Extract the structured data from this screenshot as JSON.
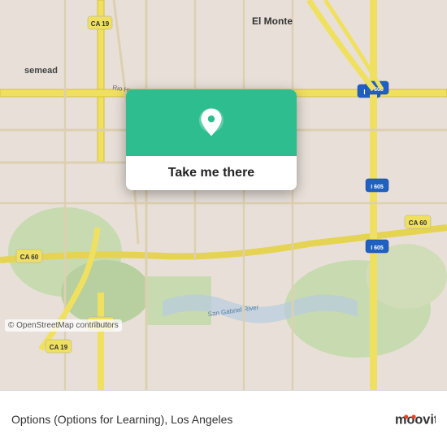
{
  "map": {
    "alt": "Street map of El Monte and Los Angeles area"
  },
  "popup": {
    "button_label": "Take me there",
    "icon_name": "location-pin-icon"
  },
  "attribution": {
    "text": "© OpenStreetMap contributors"
  },
  "bottom_bar": {
    "location_text": "Options (Options for Learning), Los Angeles",
    "logo_text": "moovit"
  }
}
